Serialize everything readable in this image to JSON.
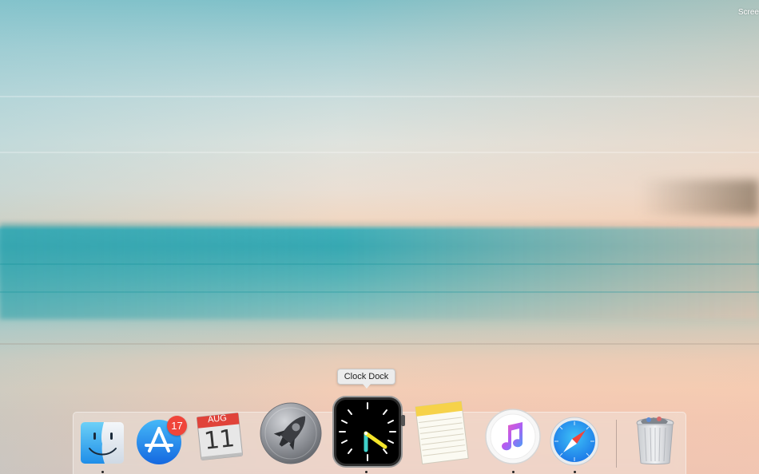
{
  "desktop": {
    "corner_label": "Scree"
  },
  "tooltip": {
    "text": "Clock Dock"
  },
  "dock": {
    "items": [
      {
        "name": "Finder",
        "icon": "finder-icon",
        "running": true
      },
      {
        "name": "App Store",
        "icon": "app-store-icon",
        "badge": "17",
        "running": false
      },
      {
        "name": "Calendar",
        "icon": "calendar-icon",
        "month": "AUG",
        "day": "11",
        "running": false
      },
      {
        "name": "Launchpad",
        "icon": "rocket-icon",
        "running": false
      },
      {
        "name": "Clock Dock",
        "icon": "clock-icon",
        "running": true
      },
      {
        "name": "Notes",
        "icon": "notes-icon",
        "running": false
      },
      {
        "name": "iTunes",
        "icon": "music-note-icon",
        "running": true
      },
      {
        "name": "Safari",
        "icon": "compass-icon",
        "running": true
      },
      {
        "name": "Trash",
        "icon": "trash-icon",
        "running": false
      }
    ]
  },
  "colors": {
    "badge": "#f0453a",
    "clock_hour_hand": "#f5e52a",
    "clock_minute_hand": "#3fd0c9",
    "safari_blue": "#1d7ae8"
  }
}
